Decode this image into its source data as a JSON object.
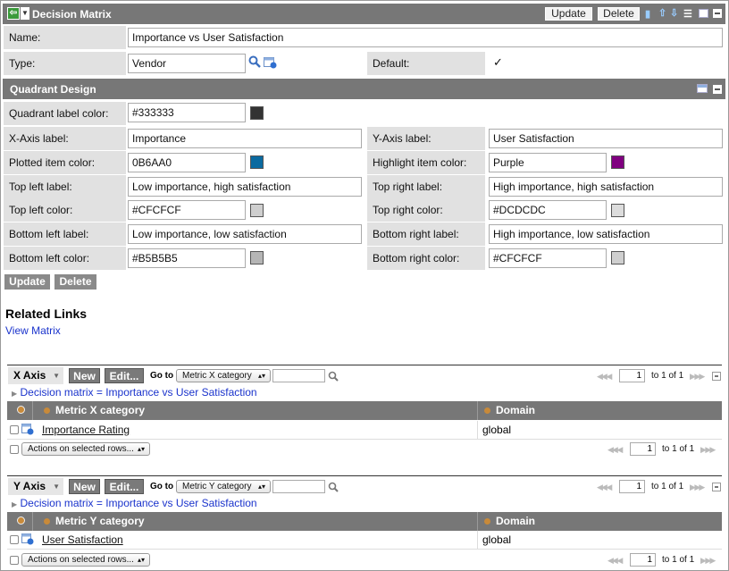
{
  "header": {
    "title": "Decision Matrix",
    "update_label": "Update",
    "delete_label": "Delete"
  },
  "form": {
    "name_label": "Name:",
    "name_value": "Importance vs User Satisfaction",
    "type_label": "Type:",
    "type_value": "Vendor",
    "default_label": "Default:",
    "default_checked": "✓"
  },
  "quadrant": {
    "title": "Quadrant Design",
    "quadrant_label_color_label": "Quadrant label color:",
    "quadrant_label_color_value": "#333333",
    "quadrant_label_color_swatch": "#333333",
    "x_axis_label": "X-Axis label:",
    "x_axis_value": "Importance",
    "y_axis_label": "Y-Axis label:",
    "y_axis_value": "User Satisfaction",
    "plotted_item_color_label": "Plotted item color:",
    "plotted_item_color_value": "0B6AA0",
    "plotted_item_color_swatch": "#0B6AA0",
    "highlight_item_color_label": "Highlight item color:",
    "highlight_item_color_value": "Purple",
    "highlight_item_color_swatch": "#800080",
    "top_left_label_label": "Top left label:",
    "top_left_label_value": "Low importance, high satisfaction",
    "top_right_label_label": "Top right label:",
    "top_right_label_value": "High importance, high satisfaction",
    "top_left_color_label": "Top left color:",
    "top_left_color_value": "#CFCFCF",
    "top_left_color_swatch": "#CFCFCF",
    "top_right_color_label": "Top right color:",
    "top_right_color_value": "#DCDCDC",
    "top_right_color_swatch": "#DCDCDC",
    "bottom_left_label_label": "Bottom left label:",
    "bottom_left_label_value": "Low importance, low satisfaction",
    "bottom_right_label_label": "Bottom right label:",
    "bottom_right_label_value": "High importance, low satisfaction",
    "bottom_left_color_label": "Bottom left color:",
    "bottom_left_color_value": "#B5B5B5",
    "bottom_left_color_swatch": "#B5B5B5",
    "bottom_right_color_label": "Bottom right color:",
    "bottom_right_color_value": "#CFCFCF",
    "bottom_right_color_swatch": "#CFCFCF"
  },
  "actions": {
    "update_label": "Update",
    "delete_label": "Delete"
  },
  "related": {
    "title": "Related Links",
    "view_matrix": "View Matrix"
  },
  "x_section": {
    "title": "X Axis",
    "new_label": "New",
    "edit_label": "Edit...",
    "goto_label": "Go to",
    "goto_select": "Metric X category",
    "goto_input": "",
    "page_top": "1",
    "of_top": "to 1 of 1",
    "filter": "Decision matrix = Importance vs User Satisfaction",
    "col_metric": "Metric X category",
    "col_domain": "Domain",
    "rows": [
      {
        "metric": "Importance Rating",
        "domain": "global"
      }
    ],
    "actions_select": "Actions on selected rows...",
    "page_bottom": "1",
    "of_bottom": "to 1 of 1"
  },
  "y_section": {
    "title": "Y Axis",
    "new_label": "New",
    "edit_label": "Edit...",
    "goto_label": "Go to",
    "goto_select": "Metric Y category",
    "goto_input": "",
    "page_top": "1",
    "of_top": "to 1 of 1",
    "filter": "Decision matrix = Importance vs User Satisfaction",
    "col_metric": "Metric Y category",
    "col_domain": "Domain",
    "rows": [
      {
        "metric": "User Satisfaction",
        "domain": "global"
      }
    ],
    "actions_select": "Actions on selected rows...",
    "page_bottom": "1",
    "of_bottom": "to 1 of 1"
  }
}
